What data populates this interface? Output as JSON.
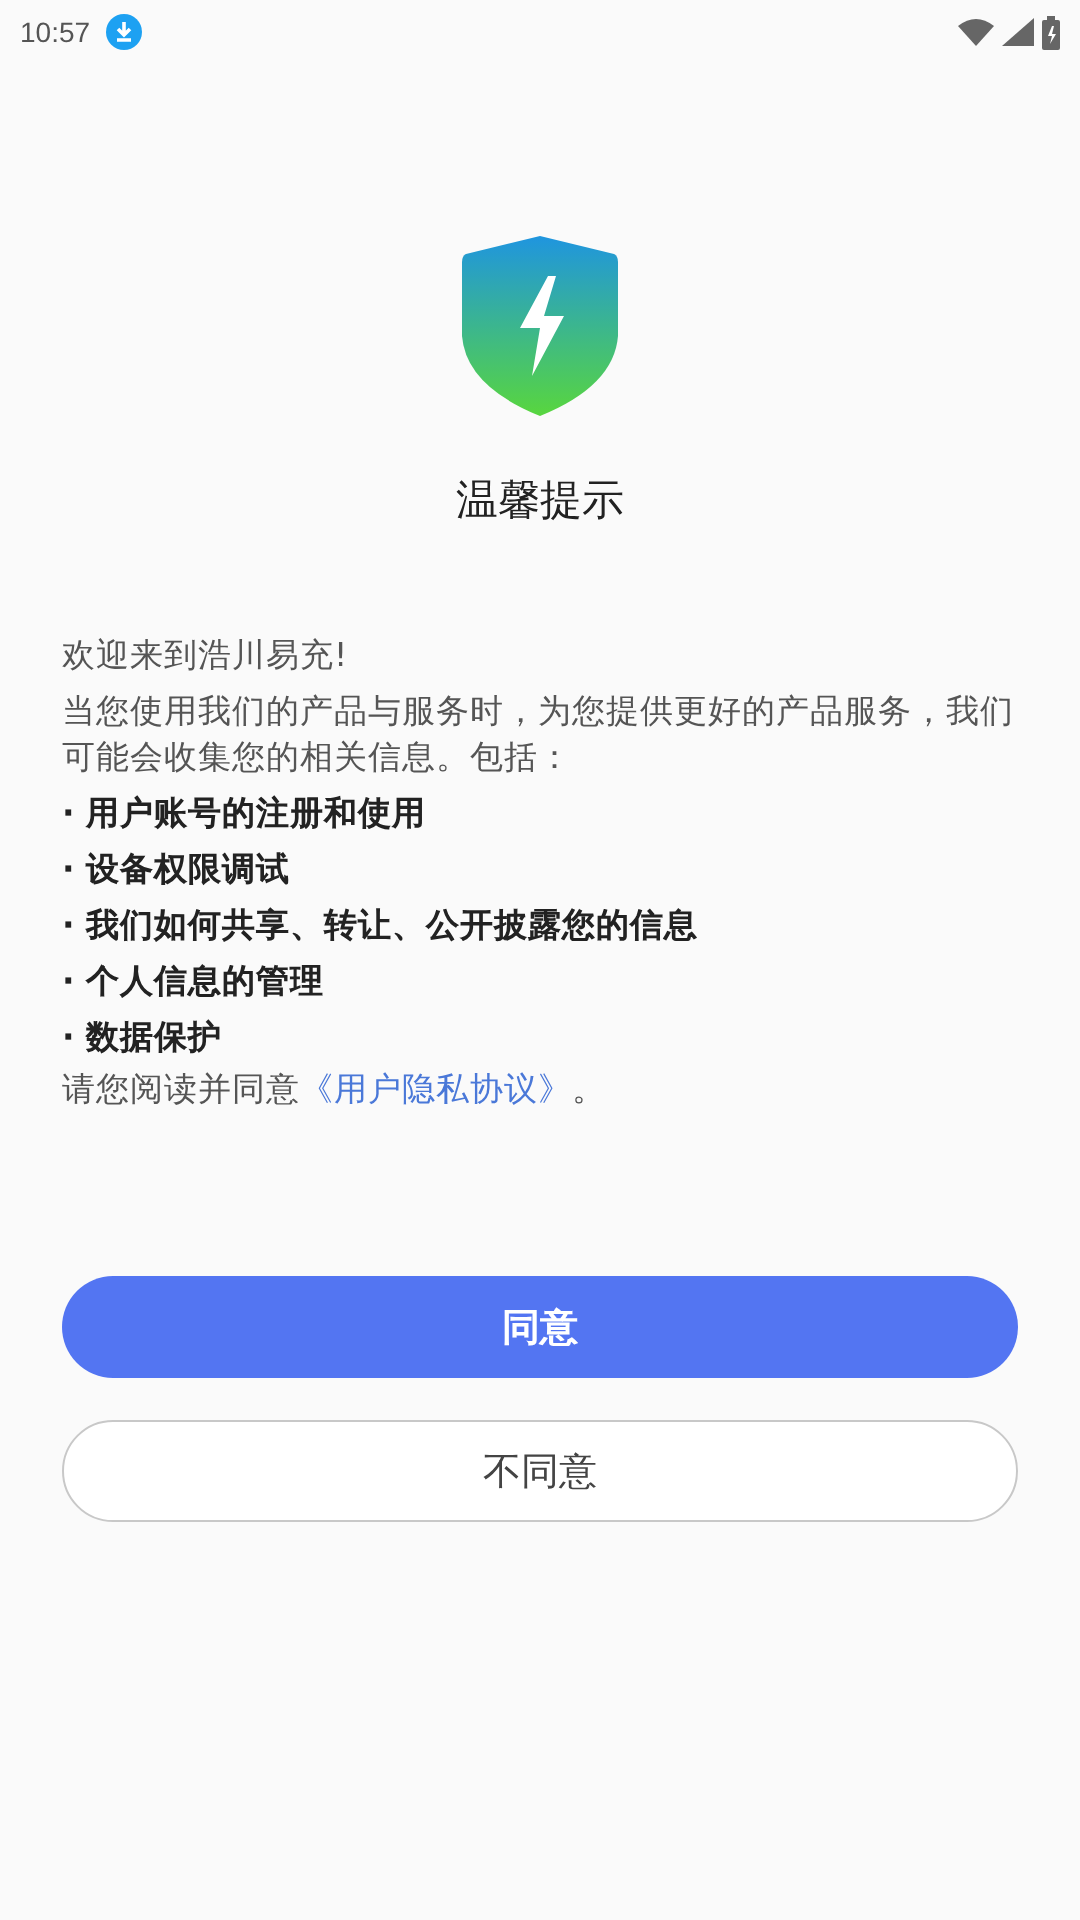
{
  "status_bar": {
    "time": "10:57"
  },
  "title": "温馨提示",
  "welcome": "欢迎来到浩川易充!",
  "intro": "当您使用我们的产品与服务时，为您提供更好的产品服务，我们可能会收集您的相关信息。包括：",
  "items": [
    "· 用户账号的注册和使用",
    "· 设备权限调试",
    "· 我们如何共享、转让、公开披露您的信息",
    "· 个人信息的管理",
    "· 数据保护"
  ],
  "consent": {
    "before": "请您阅读并同意",
    "link": "《用户隐私协议》",
    "after": "。"
  },
  "buttons": [
    {
      "label": "同意",
      "kind": "primary"
    },
    {
      "label": "不同意",
      "kind": "secondary"
    }
  ]
}
